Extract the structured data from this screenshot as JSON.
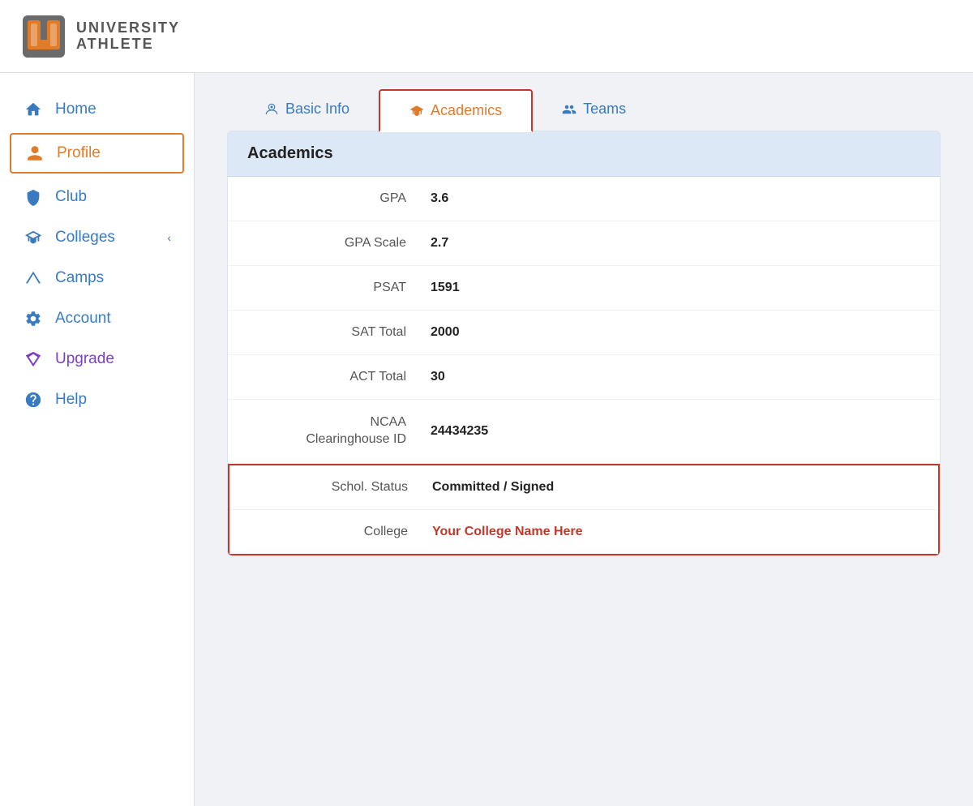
{
  "logo": {
    "text_university": "UNIVERSITY",
    "text_athlete": "ATHLETE"
  },
  "sidebar": {
    "items": [
      {
        "id": "home",
        "label": "Home",
        "icon": "home",
        "active": false
      },
      {
        "id": "profile",
        "label": "Profile",
        "icon": "user",
        "active": true
      },
      {
        "id": "club",
        "label": "Club",
        "icon": "shield",
        "active": false
      },
      {
        "id": "colleges",
        "label": "Colleges",
        "icon": "graduation",
        "active": false,
        "chevron": true
      },
      {
        "id": "camps",
        "label": "Camps",
        "icon": "tent",
        "active": false
      },
      {
        "id": "account",
        "label": "Account",
        "icon": "gear",
        "active": false
      },
      {
        "id": "upgrade",
        "label": "Upgrade",
        "icon": "gem",
        "active": false
      },
      {
        "id": "help",
        "label": "Help",
        "icon": "question",
        "active": false
      }
    ]
  },
  "tabs": [
    {
      "id": "basic-info",
      "label": "Basic Info",
      "icon": "person",
      "active": false
    },
    {
      "id": "academics",
      "label": "Academics",
      "icon": "graduation",
      "active": true
    },
    {
      "id": "teams",
      "label": "Teams",
      "icon": "group",
      "active": false
    }
  ],
  "academics": {
    "section_title": "Academics",
    "fields": [
      {
        "label": "GPA",
        "value": "3.6",
        "highlighted": false
      },
      {
        "label": "GPA Scale",
        "value": "2.7",
        "highlighted": false
      },
      {
        "label": "PSAT",
        "value": "1591",
        "highlighted": false
      },
      {
        "label": "SAT Total",
        "value": "2000",
        "highlighted": false
      },
      {
        "label": "ACT Total",
        "value": "30",
        "highlighted": false
      },
      {
        "label": "NCAA Clearinghouse ID",
        "value": "24434235",
        "highlighted": false
      },
      {
        "label": "Schol. Status",
        "value": "Committed / Signed",
        "highlighted": true,
        "valueColor": "normal"
      },
      {
        "label": "College",
        "value": "Your College Name Here",
        "highlighted": true,
        "valueColor": "red"
      }
    ]
  }
}
